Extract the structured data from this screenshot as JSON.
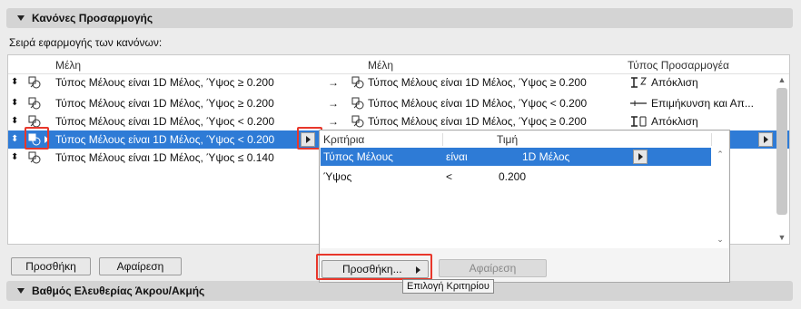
{
  "header_top": {
    "title": "Κανόνες Προσαρμογής"
  },
  "order_label": "Σειρά εφαρμογής των κανόνων:",
  "table": {
    "columns": {
      "members_left": "Μέλη",
      "members_right": "Μέλη",
      "adjust_type": "Τύπος Προσαρμογέα"
    },
    "rows": [
      {
        "left": "Τύπος Μέλους είναι 1D Μέλος, Ύψος ≥ 0.200",
        "right": "Τύπος Μέλους είναι 1D Μέλος, Ύψος ≥ 0.200",
        "type": "Απόκλιση",
        "type_icon": "offset-icon"
      },
      {
        "left": "Τύπος Μέλους είναι 1D Μέλος, Ύψος ≥ 0.200",
        "right": "Τύπος Μέλους είναι 1D Μέλος, Ύψος < 0.200",
        "type": "Επιμήκυνση και Απ...",
        "type_icon": "extend-icon"
      },
      {
        "left": "Τύπος Μέλους είναι 1D Μέλος, Ύψος < 0.200",
        "right": "Τύπος Μέλους είναι 1D Μέλος, Ύψος ≥ 0.200",
        "type": "Απόκλιση",
        "type_icon": "offset-icon"
      },
      {
        "left": "Τύπος Μέλους είναι 1D Μέλος, Ύψος < 0.200",
        "selected": true
      },
      {
        "left": "Τύπος Μέλους είναι 1D Μέλος, Ύψος ≤ 0.140"
      }
    ]
  },
  "buttons": {
    "add": "Προσθήκη",
    "remove": "Αφαίρεση"
  },
  "popup": {
    "columns": {
      "criteria": "Κριτήρια",
      "value": "Τιμή"
    },
    "rows": [
      {
        "criterion": "Τύπος Μέλους",
        "op": "είναι",
        "value": "1D Μέλος",
        "selected": true
      },
      {
        "criterion": "Ύψος",
        "op": "<",
        "value": "0.200"
      }
    ],
    "add_label": "Προσθήκη...",
    "remove_label": "Αφαίρεση",
    "tooltip": "Επιλογή Κριτηρίου"
  },
  "header_bottom": {
    "title": "Βαθμός Ελευθερίας Άκρου/Ακμής"
  },
  "colors": {
    "selection": "#2e7bd6",
    "highlight": "#e8372b"
  }
}
